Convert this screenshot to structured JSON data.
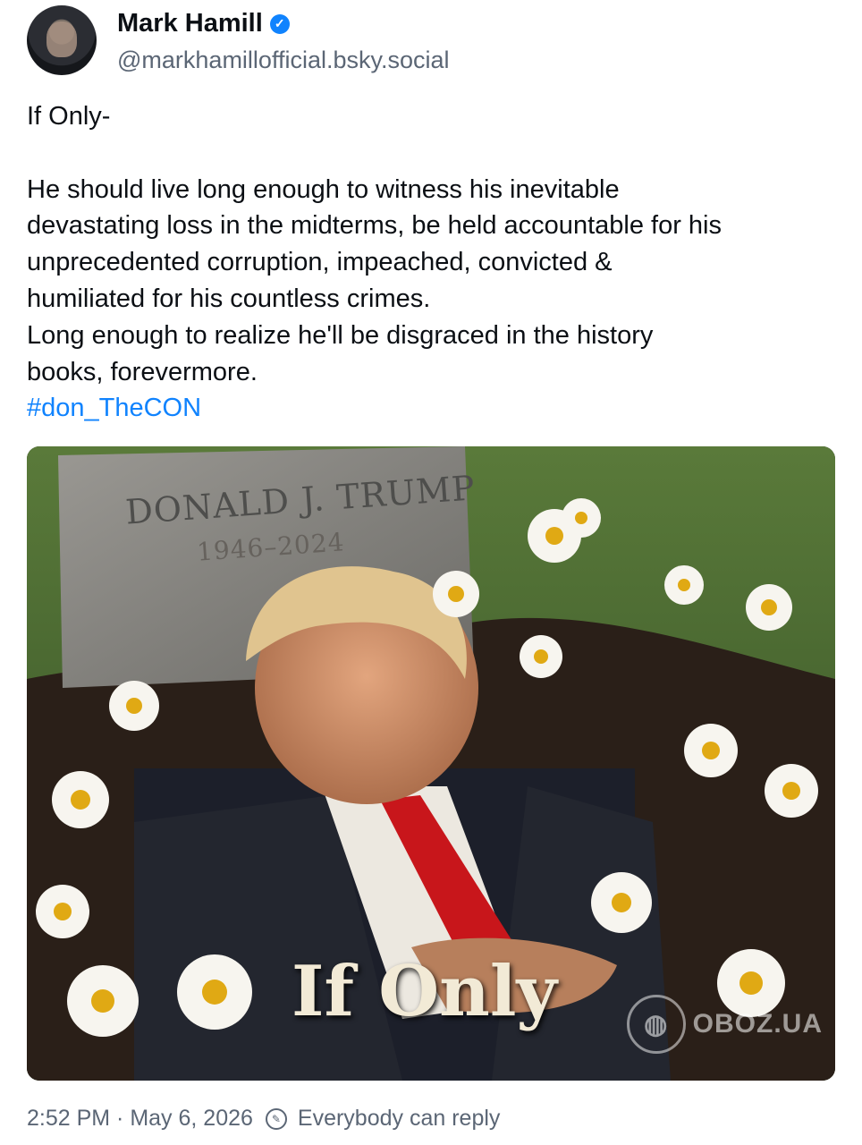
{
  "author": {
    "display_name": "Mark Hamill",
    "handle": "@markhamillofficial.bsky.social",
    "avatar_icon": "avatar-photo",
    "verified_icon": "verified-check-icon",
    "verified_color": "#1083fe"
  },
  "post": {
    "title_line": "If Only-",
    "lines": [
      "He should live long enough to witness his inevitable",
      "devastating loss in the midterms, be held accountable for his",
      "unprecedented corruption, impeached, convicted &",
      "humiliated for his countless crimes.",
      "Long enough to realize he'll be disgraced in the history",
      "books, forevermore."
    ],
    "hashtag": "#don_TheCON",
    "hashtag_color": "#1083fe"
  },
  "media": {
    "headstone_name": "DONALD J. TRUMP",
    "headstone_years": "1946–2024",
    "overlay_caption": "If Only",
    "watermark": "OBOZ.UA"
  },
  "meta": {
    "timestamp": "2:52 PM · May 6, 2026",
    "reply_setting": "Everybody can reply",
    "reply_icon": "reply-settings-icon"
  }
}
